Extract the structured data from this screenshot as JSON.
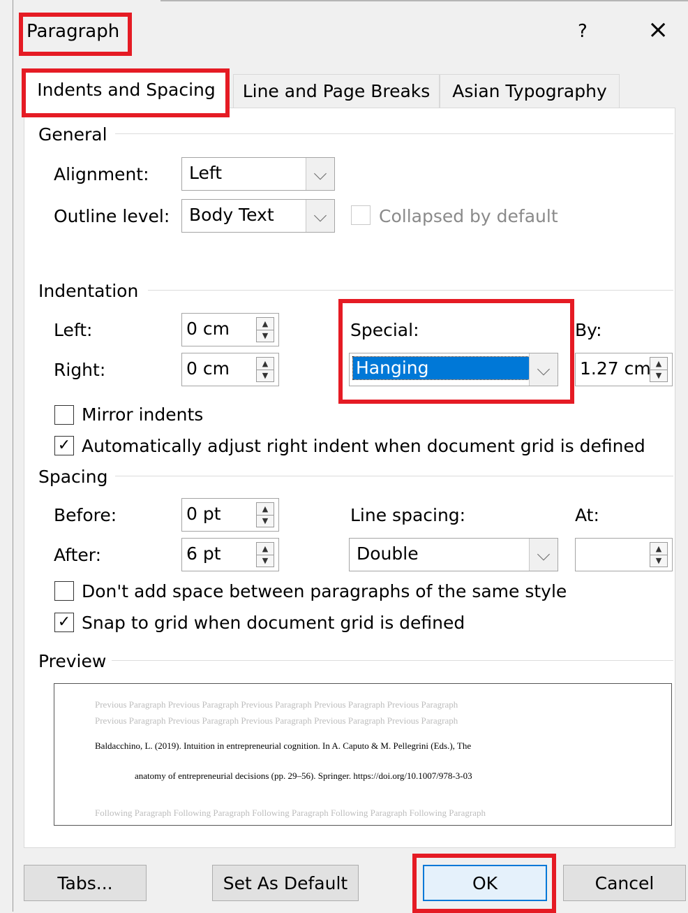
{
  "dialog": {
    "title": "Paragraph",
    "help": "?",
    "close": "×"
  },
  "tabs": [
    {
      "label": "Indents and Spacing",
      "active": true
    },
    {
      "label": "Line and Page Breaks",
      "active": false
    },
    {
      "label": "Asian Typography",
      "active": false
    }
  ],
  "general": {
    "heading": "General",
    "alignment_label": "Alignment:",
    "alignment_value": "Left",
    "outline_label": "Outline level:",
    "outline_value": "Body Text",
    "collapsed_label": "Collapsed by default",
    "collapsed_checked": false
  },
  "indentation": {
    "heading": "Indentation",
    "left_label": "Left:",
    "left_value": "0 cm",
    "right_label": "Right:",
    "right_value": "0 cm",
    "special_label": "Special:",
    "special_value": "Hanging",
    "by_label": "By:",
    "by_value": "1.27 cm",
    "mirror_label": "Mirror indents",
    "mirror_checked": false,
    "auto_adjust_label": "Automatically adjust right indent when document grid is defined",
    "auto_adjust_checked": true
  },
  "spacing": {
    "heading": "Spacing",
    "before_label": "Before:",
    "before_value": "0 pt",
    "after_label": "After:",
    "after_value": "6 pt",
    "line_spacing_label": "Line spacing:",
    "line_spacing_value": "Double",
    "at_label": "At:",
    "at_value": "",
    "no_space_label": "Don't add space between paragraphs of the same style",
    "no_space_checked": false,
    "snap_label": "Snap to grid when document grid is defined",
    "snap_checked": true
  },
  "preview": {
    "heading": "Preview",
    "previous_1": "Previous Paragraph Previous Paragraph Previous Paragraph Previous Paragraph Previous Paragraph",
    "previous_2": "Previous Paragraph Previous Paragraph Previous Paragraph Previous Paragraph Previous Paragraph",
    "sample_1": "Baldacchino, L. (2019). Intuition in entrepreneurial cognition. In A. Caputo & M. Pellegrini (Eds.), The",
    "sample_2": "anatomy of entrepreneurial decisions (pp. 29–56). Springer. https://doi.org/10.1007/978-3-03",
    "following": "Following Paragraph Following Paragraph Following Paragraph Following Paragraph Following Paragraph"
  },
  "buttons": {
    "tabs": "Tabs...",
    "set_default": "Set As Default",
    "ok": "OK",
    "cancel": "Cancel"
  },
  "colors": {
    "highlight": "#e51b24",
    "selection": "#0078d7"
  }
}
